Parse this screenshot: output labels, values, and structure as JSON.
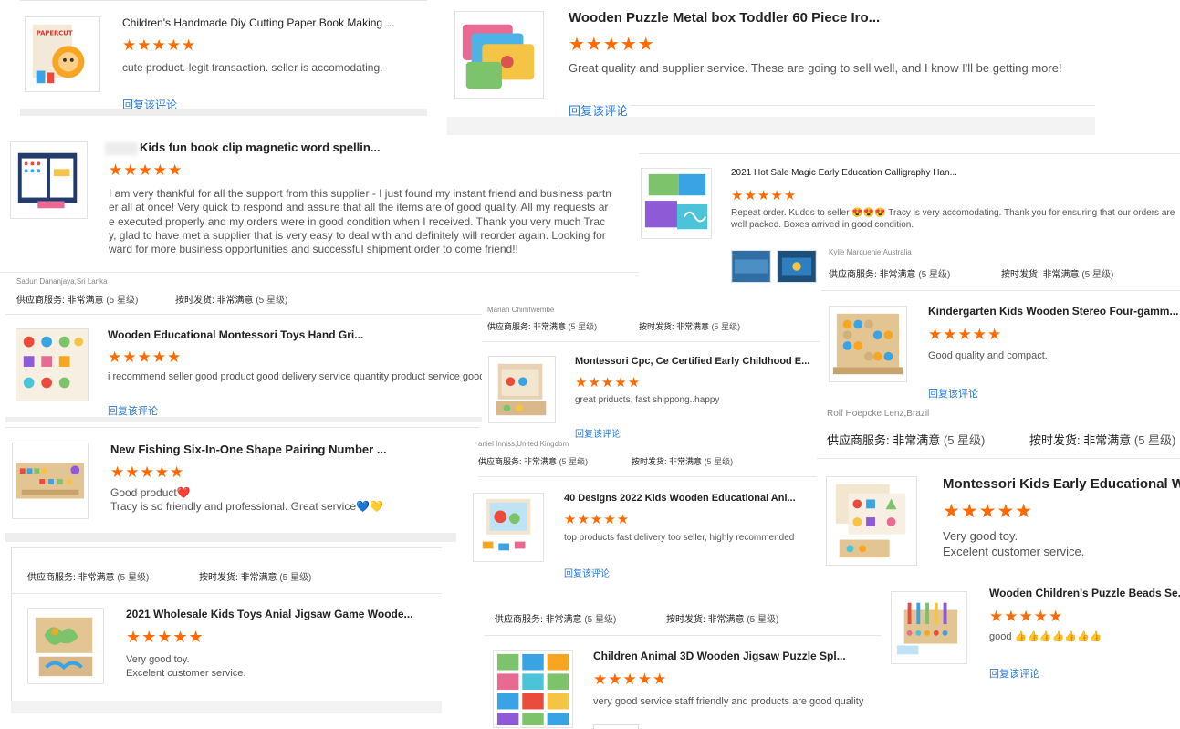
{
  "reply_label": "回复该评论",
  "stars": "★★★★★",
  "meta_supplier_label": "供应商服务:",
  "meta_delivery_label": "按时发货:",
  "meta_value": "非常满意",
  "meta_rating": "(5 星级)",
  "reviews": [
    {
      "title": "Children's Handmade Diy Cutting Paper Book Making ...",
      "text": "cute product. legit transaction. seller is accomodating."
    },
    {
      "title": "Wooden Puzzle Metal box Toddler 60 Piece Iro...",
      "text": "Great quality and supplier service. These are going to sell well, and I know I'll be getting more!"
    },
    {
      "title": "Kids fun book clip magnetic word spellin...",
      "text": "I am very thankful for all the support from this supplier - I just found my instant friend and business partner all at once! Very quick to respond and assure that all the items are of good quality. All my requests are executed properly and my orders were in good condition when I received. Thank you very much Tracy, glad to have met a supplier that is very easy to deal with and definitely will reorder again. Looking forward for more business opportunities and successful shipment order to come friend!!"
    },
    {
      "title": "2021 Hot Sale Magic Early Education Calligraphy Han...",
      "text": "Repeat order. Kudos to seller 😍😍😍 Tracy is very accomodating. Thank you for ensuring that our orders are well packed. Boxes arrived in good condition."
    },
    {
      "title": "Wooden Educational Montessori Toys Hand Gri...",
      "text": "i recommend seller good product good delivery service quantity product service good"
    },
    {
      "title": "Montessori Cpc, Ce Certified Early Childhood E...",
      "text": "great priducts, fast shippong..happy"
    },
    {
      "title": "Kindergarten Kids Wooden Stereo Four-gamm...",
      "text": "Good quality and compact."
    },
    {
      "title": "New Fishing Six-In-One Shape Pairing Number ...",
      "text_line1": "Good product❤️",
      "text_line2": "Tracy is so friendly and professional. Great service💙💛"
    },
    {
      "title": "40 Designs 2022 Kids Wooden Educational Ani...",
      "text": "top products fast delivery too seller, highly recommended"
    },
    {
      "title": "Montessori Kids Early Educational Wo...",
      "text_line1": "Very good toy.",
      "text_line2": "Excelent customer service."
    },
    {
      "title": "2021 Wholesale Kids Toys Anial Jigsaw Game Woode...",
      "text_line1": "Very good toy.",
      "text_line2": "Excelent customer service."
    },
    {
      "title": "Wooden Children's Puzzle Beads Se...",
      "text": "good 👍👍👍👍👍👍👍"
    },
    {
      "title": "Children Animal 3D Wooden Jigsaw Puzzle Spl...",
      "text": "very good service staff friendly and products are good quality"
    }
  ],
  "reviewers": {
    "sadun": "Sadun Dananjaya,Sri Lanka",
    "kylie": "Kylie Marquenie,Australia",
    "mariah": "Mariah Chimfwembe",
    "rolf": "Rolf Hoepcke Lenz,Brazil",
    "daniel": "aniel Inniss,United Kingdom"
  },
  "colors": {
    "star": "#ff6a00",
    "link": "#2a7ad6"
  }
}
